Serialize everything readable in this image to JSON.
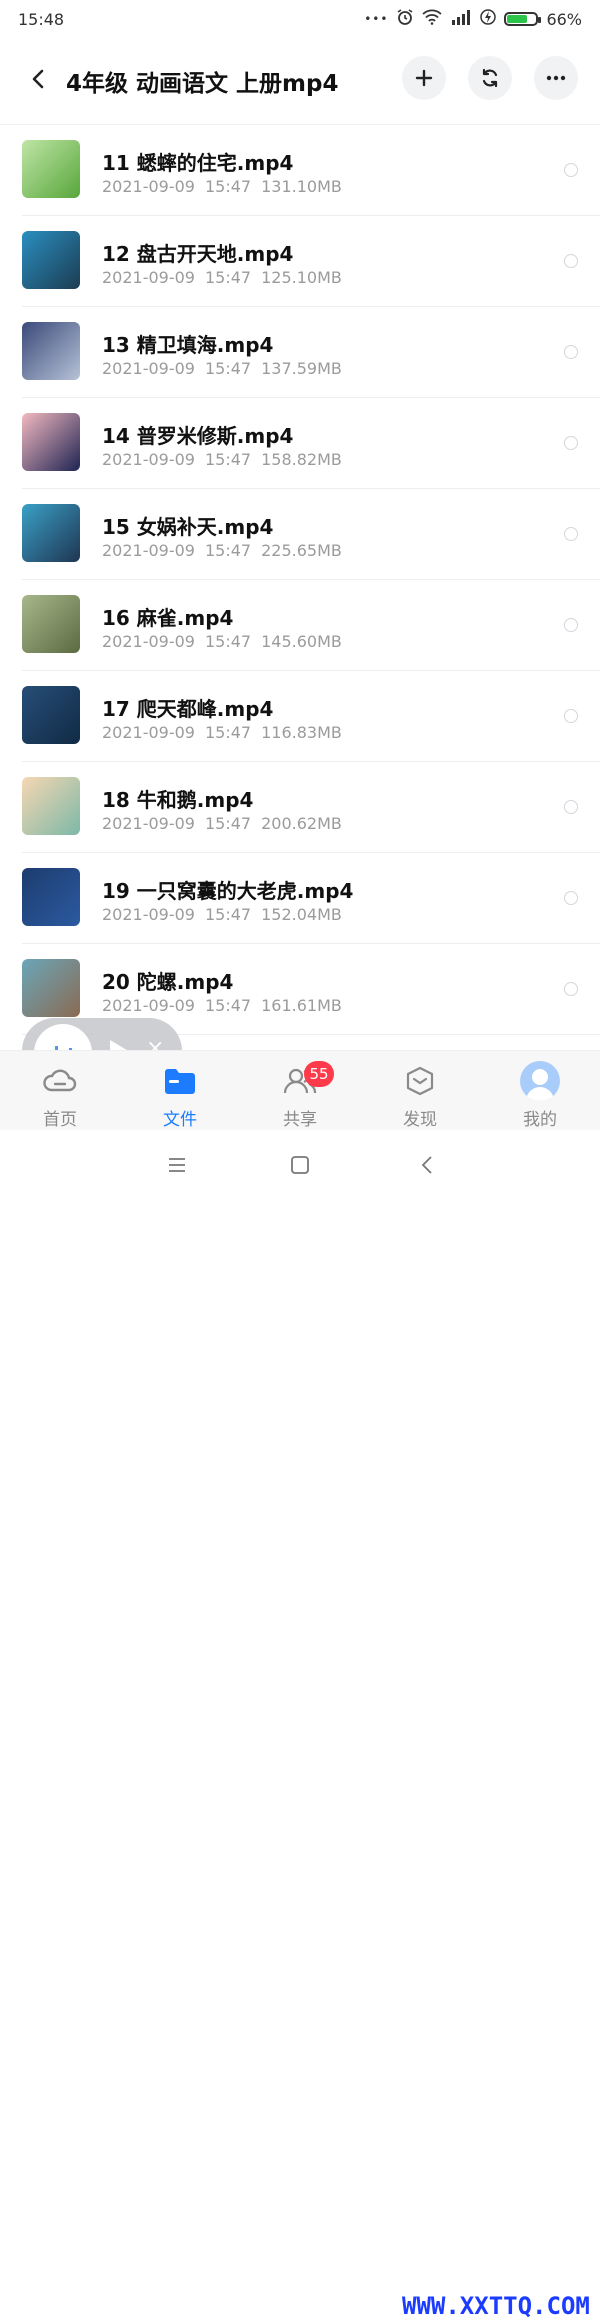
{
  "status_bar": {
    "time": "15:48",
    "dots": "•••",
    "battery_text": "66%",
    "battery_level": 0.66
  },
  "header": {
    "title": "4年级 动画语文 上册mp4"
  },
  "files": [
    {
      "name": "11 蟋蟀的住宅.mp4",
      "date": "2021-09-09",
      "time": "15:47",
      "size": "131.10MB",
      "thumb_colors": [
        "#bfe5a6",
        "#58a63b"
      ]
    },
    {
      "name": "12 盘古开天地.mp4",
      "date": "2021-09-09",
      "time": "15:47",
      "size": "125.10MB",
      "thumb_colors": [
        "#2a8fc0",
        "#1c3b52"
      ]
    },
    {
      "name": "13 精卫填海.mp4",
      "date": "2021-09-09",
      "time": "15:47",
      "size": "137.59MB",
      "thumb_colors": [
        "#3b4a7a",
        "#b6c2d6"
      ]
    },
    {
      "name": "14 普罗米修斯.mp4",
      "date": "2021-09-09",
      "time": "15:47",
      "size": "158.82MB",
      "thumb_colors": [
        "#f3b9c0",
        "#1f2453"
      ]
    },
    {
      "name": "15 女娲补天.mp4",
      "date": "2021-09-09",
      "time": "15:47",
      "size": "225.65MB",
      "thumb_colors": [
        "#3aa0c6",
        "#1f3552"
      ]
    },
    {
      "name": "16 麻雀.mp4",
      "date": "2021-09-09",
      "time": "15:47",
      "size": "145.60MB",
      "thumb_colors": [
        "#a8b78b",
        "#5b6a41"
      ]
    },
    {
      "name": "17 爬天都峰.mp4",
      "date": "2021-09-09",
      "time": "15:47",
      "size": "116.83MB",
      "thumb_colors": [
        "#274e78",
        "#102a44"
      ]
    },
    {
      "name": "18 牛和鹅.mp4",
      "date": "2021-09-09",
      "time": "15:47",
      "size": "200.62MB",
      "thumb_colors": [
        "#f6d7b3",
        "#7cb8a6"
      ]
    },
    {
      "name": "19 一只窝囊的大老虎.mp4",
      "date": "2021-09-09",
      "time": "15:47",
      "size": "152.04MB",
      "thumb_colors": [
        "#1d3c6e",
        "#2b5aa0"
      ]
    },
    {
      "name": "20 陀螺.mp4",
      "date": "2021-09-09",
      "time": "15:47",
      "size": "161.61MB",
      "thumb_colors": [
        "#6aa6b9",
        "#8a6a52"
      ]
    }
  ],
  "tabs": [
    {
      "label": "首页",
      "icon": "cloud-icon",
      "active": false
    },
    {
      "label": "文件",
      "icon": "folder-icon",
      "active": true
    },
    {
      "label": "共享",
      "icon": "people-icon",
      "active": false,
      "badge": "55"
    },
    {
      "label": "发现",
      "icon": "cube-icon",
      "active": false
    },
    {
      "label": "我的",
      "icon": "avatar-icon",
      "active": false
    }
  ],
  "watermark": "WWW.XXTTQ.COM",
  "colors": {
    "accent": "#1d7bff",
    "badge": "#ff3b4b"
  }
}
